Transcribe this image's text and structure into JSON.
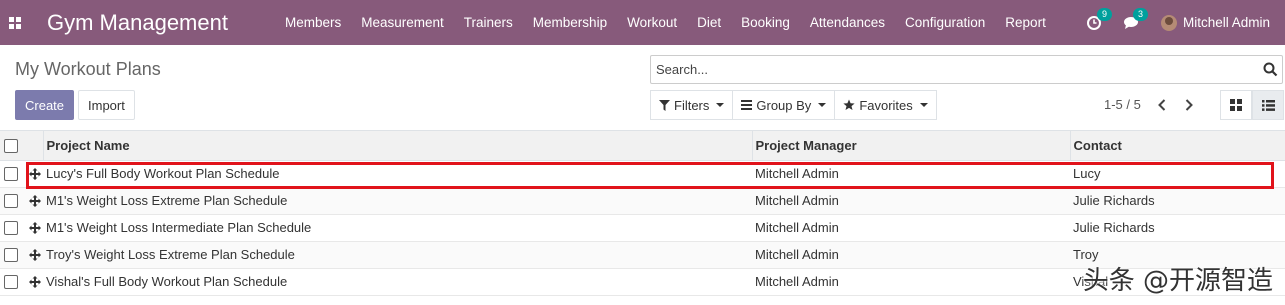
{
  "navbar": {
    "app_title": "Gym Management",
    "menu": [
      "Members",
      "Measurement",
      "Trainers",
      "Membership",
      "Workout",
      "Diet",
      "Booking",
      "Attendances",
      "Configuration",
      "Report"
    ],
    "activity_count": "9",
    "message_count": "3",
    "user_name": "Mitchell Admin",
    "color": "#875a7b"
  },
  "control_panel": {
    "breadcrumb": "My Workout Plans",
    "create_label": "Create",
    "import_label": "Import",
    "search_placeholder": "Search...",
    "filters_label": "Filters",
    "group_by_label": "Group By",
    "favorites_label": "Favorites",
    "pager": "1-5 / 5",
    "active_view": "list",
    "accent_color": "#7c7bad"
  },
  "list": {
    "columns": [
      "Project Name",
      "Project Manager",
      "Contact"
    ],
    "rows": [
      {
        "name": "Lucy's Full Body Workout Plan Schedule",
        "manager": "Mitchell Admin",
        "contact": "Lucy"
      },
      {
        "name": "M1's Weight Loss Extreme Plan Schedule",
        "manager": "Mitchell Admin",
        "contact": "Julie Richards"
      },
      {
        "name": "M1's Weight Loss Intermediate Plan Schedule",
        "manager": "Mitchell Admin",
        "contact": "Julie Richards"
      },
      {
        "name": "Troy's Weight Loss Extreme Plan Schedule",
        "manager": "Mitchell Admin",
        "contact": "Troy"
      },
      {
        "name": "Vishal's Full Body Workout Plan Schedule",
        "manager": "Mitchell Admin",
        "contact": "Vishal"
      }
    ],
    "highlight_color": "#e1131b"
  },
  "watermark": "头条 @开源智造"
}
